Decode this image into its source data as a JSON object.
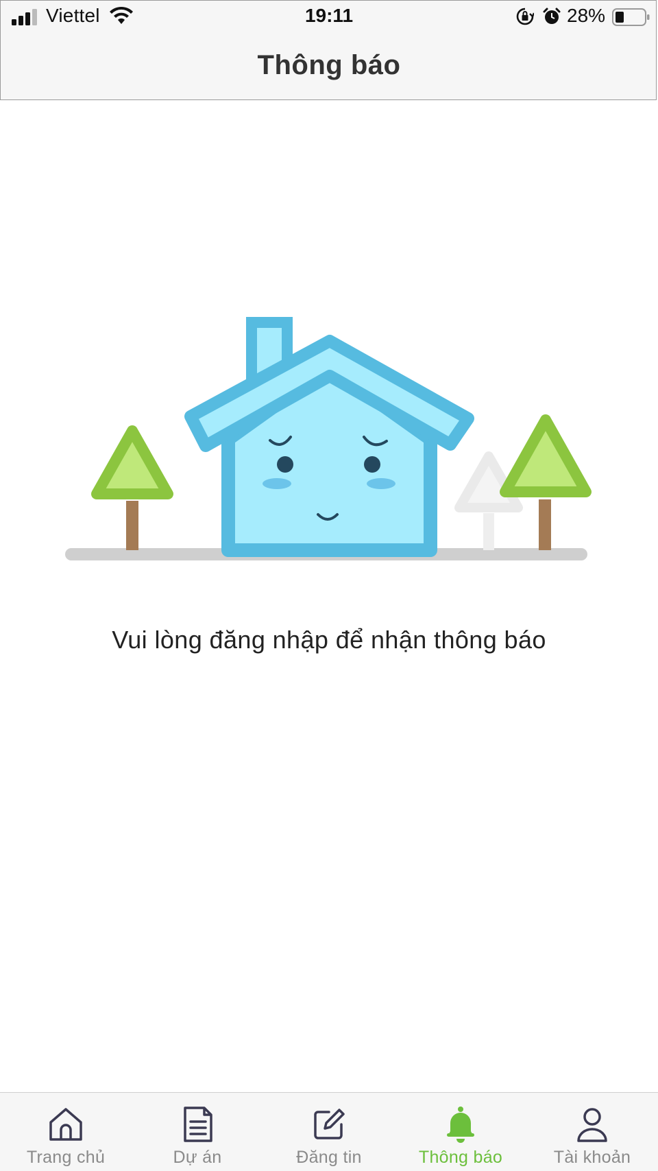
{
  "status_bar": {
    "carrier": "Viettel",
    "time": "19:11",
    "battery": "28%"
  },
  "header": {
    "title": "Thông báo"
  },
  "main": {
    "message": "Vui lòng đăng nhập để nhận thông báo"
  },
  "tabbar": {
    "active_color": "#6cbf3c",
    "items": [
      {
        "label": "Trang chủ",
        "icon": "home-icon"
      },
      {
        "label": "Dự án",
        "icon": "document-icon"
      },
      {
        "label": "Đăng tin",
        "icon": "edit-icon"
      },
      {
        "label": "Thông báo",
        "icon": "bell-icon",
        "active": true
      },
      {
        "label": "Tài khoản",
        "icon": "user-icon"
      }
    ]
  }
}
